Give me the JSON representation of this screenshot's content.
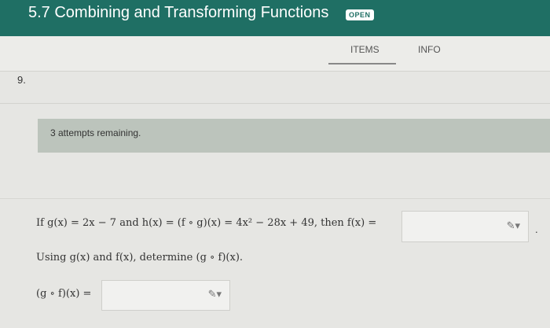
{
  "header": {
    "title": "5.7 Combining and Transforming Functions",
    "badge": "OPEN"
  },
  "tabs": [
    {
      "label": "ITEMS",
      "active": true
    },
    {
      "label": "INFO",
      "active": false
    }
  ],
  "question": {
    "number": "9.",
    "attempts": "3 attempts remaining.",
    "line1": "If g(x) = 2x − 7 and h(x) = (f ∘ g)(x) = 4x² − 28x + 49, then f(x) =",
    "line1_end": ".",
    "line2": "Using g(x) and f(x), determine (g ∘ f)(x).",
    "line3": "(g ∘ f)(x) =",
    "answer1_value": "",
    "answer2_value": ""
  },
  "icons": {
    "answer1": "pencil-icon",
    "answer2": "pencil-icon"
  },
  "colors": {
    "header_bg": "#1f6f64",
    "page_bg": "#e6e6e3",
    "attempts_bg": "#bcc4bc"
  }
}
